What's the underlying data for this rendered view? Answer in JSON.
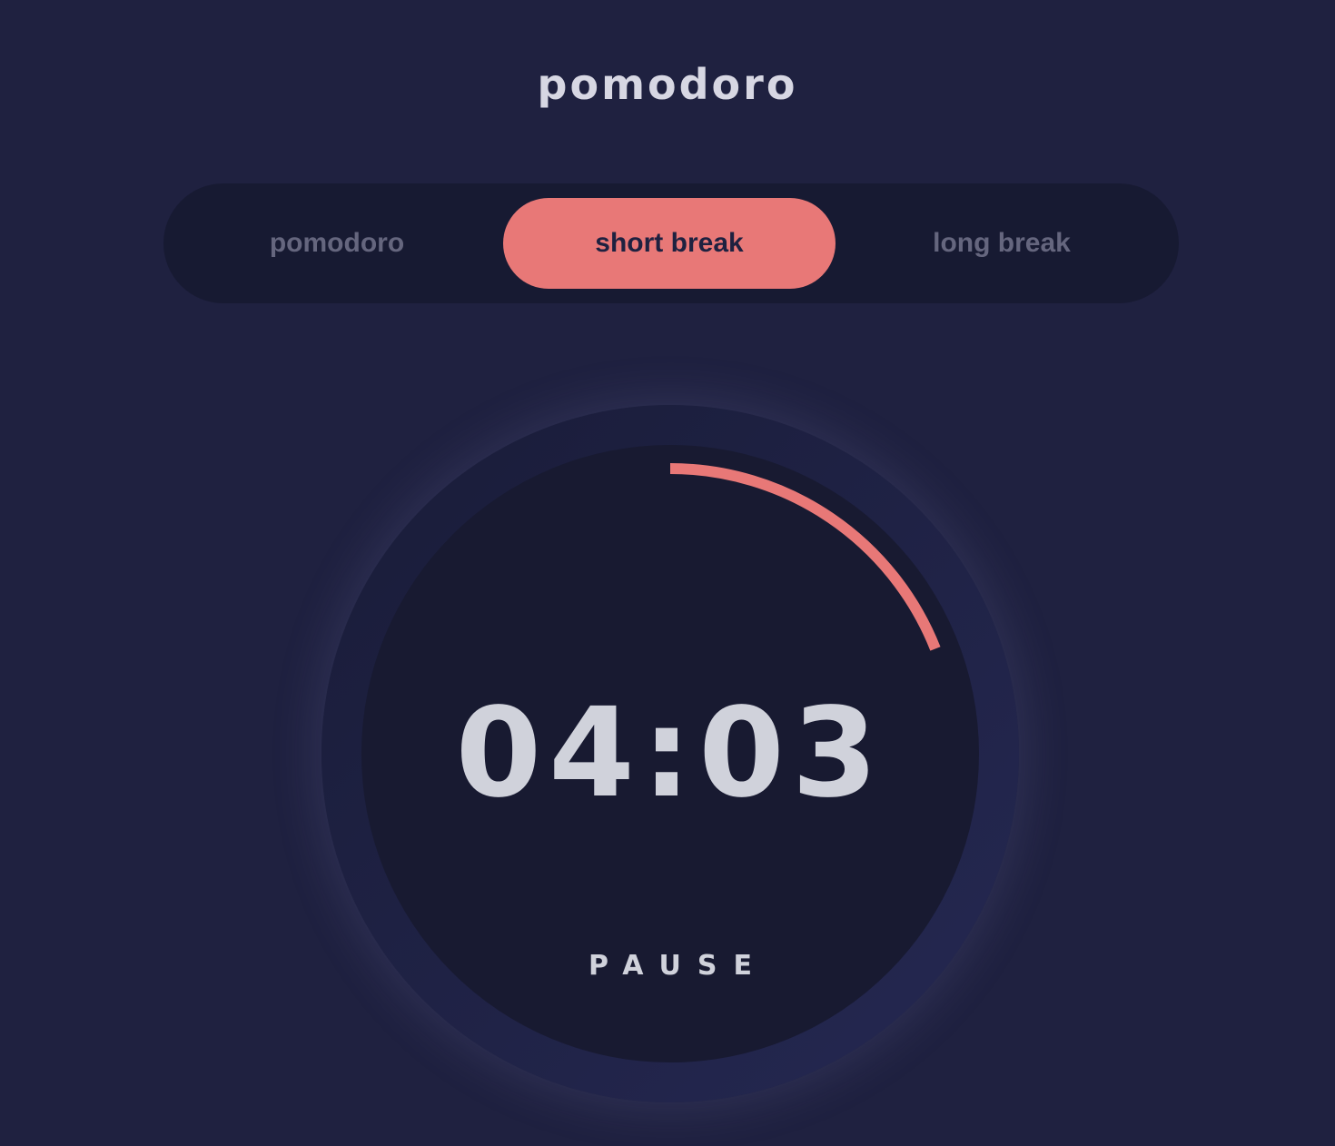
{
  "app": {
    "title": "pomodoro"
  },
  "modes": {
    "items": [
      {
        "label": "pomodoro",
        "active": false
      },
      {
        "label": "short break",
        "active": true
      },
      {
        "label": "long break",
        "active": false
      }
    ]
  },
  "timer": {
    "time": "04:03",
    "action_label": "PAUSE",
    "progress_fraction": 0.19
  },
  "colors": {
    "background": "#1f2140",
    "accent": "#e87877",
    "text": "#d7d7e3",
    "muted_text": "#65667e",
    "panel": "#171a32"
  }
}
